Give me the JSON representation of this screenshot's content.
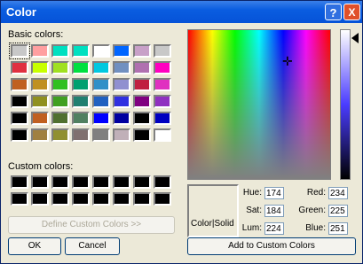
{
  "window": {
    "title": "Color"
  },
  "title_buttons": {
    "help": "?",
    "close": "X"
  },
  "labels": {
    "basic_colors": "Basic colors:",
    "custom_colors": "Custom colors:",
    "color_solid": "Color|Solid"
  },
  "basic_swatches": [
    "#c8c8c8",
    "#ff9fa0",
    "#00e0c0",
    "#00e0c0",
    "#ffffff",
    "#0066ff",
    "#c8a0c8",
    "#c8c8c8",
    "#e03040",
    "#c8ff00",
    "#a0e020",
    "#00e040",
    "#00c8e0",
    "#7090c0",
    "#b070b0",
    "#ff00c0",
    "#c06020",
    "#c09020",
    "#30c020",
    "#00a070",
    "#3090c8",
    "#9090d0",
    "#c02040",
    "#e030c0",
    "#000000",
    "#909020",
    "#40a020",
    "#208070",
    "#2060c0",
    "#3030e0",
    "#800080",
    "#9030c0",
    "#000000",
    "#c06020",
    "#507030",
    "#508060",
    "#0000ff",
    "#0000a0",
    "#000000",
    "#0000c0",
    "#000000",
    "#a08040",
    "#909030",
    "#807070",
    "#808080",
    "#c0b0b8",
    "#000000",
    "#ffffff"
  ],
  "custom_swatches": [
    "#000000",
    "#000000",
    "#000000",
    "#000000",
    "#000000",
    "#000000",
    "#000000",
    "#000000",
    "#000000",
    "#000000",
    "#000000",
    "#000000",
    "#000000",
    "#000000",
    "#000000",
    "#000000"
  ],
  "buttons": {
    "define_custom": "Define Custom Colors >>",
    "ok": "OK",
    "cancel": "Cancel",
    "add_custom": "Add to Custom Colors"
  },
  "fields": {
    "hue": {
      "label": "Hue:",
      "value": "174"
    },
    "sat": {
      "label": "Sat:",
      "value": "184"
    },
    "lum": {
      "label": "Lum:",
      "value": "224"
    },
    "red": {
      "label": "Red:",
      "value": "234"
    },
    "green": {
      "label": "Green:",
      "value": "225"
    },
    "blue": {
      "label": "Blue:",
      "value": "251"
    }
  },
  "icons": {
    "crosshair": "crosshair-icon",
    "pointer": "lum-pointer-icon"
  }
}
